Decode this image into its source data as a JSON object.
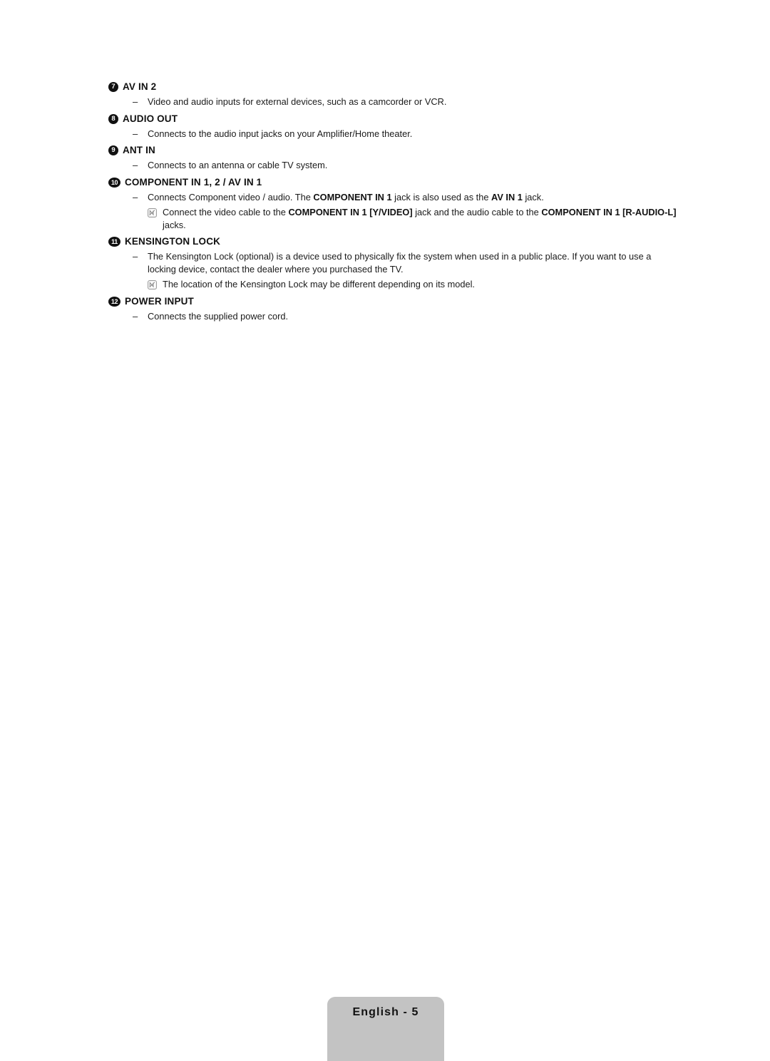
{
  "document": {
    "page_label": "English - 5",
    "footer_color": "#c3c3c3",
    "note_icon_name": "note-pen-icon"
  },
  "entries": [
    {
      "marker": "7",
      "title": "AV IN 2",
      "lines": [
        {
          "type": "dash",
          "dash": "–",
          "html": "Video and audio inputs for external devices, such as a camcorder or VCR."
        }
      ]
    },
    {
      "marker": "8",
      "title": "AUDIO OUT",
      "lines": [
        {
          "type": "dash",
          "dash": "–",
          "html": "Connects to the audio input jacks on your Amplifier/Home theater."
        }
      ]
    },
    {
      "marker": "9",
      "title": "ANT IN",
      "lines": [
        {
          "type": "dash",
          "dash": "–",
          "html": "Connects to an antenna or cable TV system."
        }
      ]
    },
    {
      "marker": "10",
      "title": "COMPONENT IN 1, 2 / AV IN 1",
      "lines": [
        {
          "type": "dash",
          "dash": "–",
          "html": "Connects Component video / audio. The <b>COMPONENT IN 1</b> jack is also used as the <b>AV IN 1</b> jack."
        },
        {
          "type": "note",
          "html": "Connect the video cable to the <b>COMPONENT IN 1 [Y/VIDEO]</b> jack and the audio cable to the <b>COMPONENT IN 1 [R-AUDIO-L]</b> jacks."
        }
      ]
    },
    {
      "marker": "11",
      "title": "KENSINGTON LOCK",
      "lines": [
        {
          "type": "dash",
          "dash": "–",
          "html": "The Kensington Lock (optional) is a device used to physically fix the system when used in a public place. If you want to use a locking device, contact the dealer where you purchased the TV."
        },
        {
          "type": "note",
          "html": "The location of the Kensington Lock may be different depending on its model."
        }
      ]
    },
    {
      "marker": "12",
      "title": "POWER INPUT",
      "lines": [
        {
          "type": "dash",
          "dash": "–",
          "html": "Connects the supplied power cord."
        }
      ]
    }
  ]
}
